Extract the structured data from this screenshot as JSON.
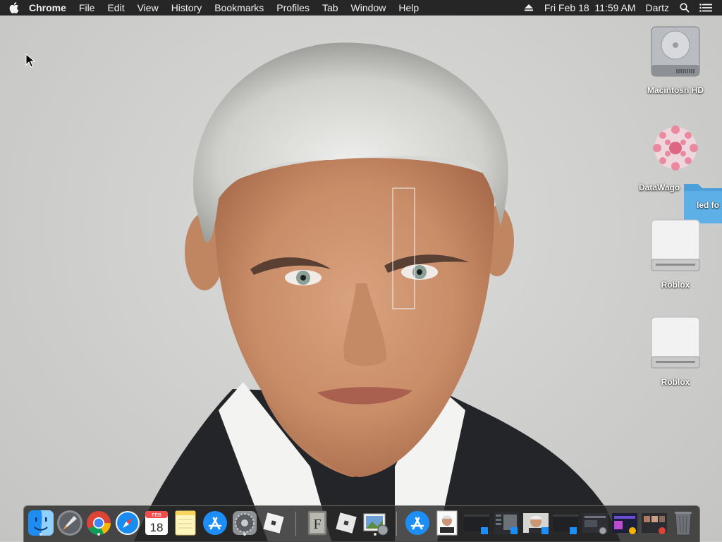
{
  "menubar": {
    "app_name": "Chrome",
    "menus": [
      "File",
      "Edit",
      "View",
      "History",
      "Bookmarks",
      "Profiles",
      "Tab",
      "Window",
      "Help"
    ],
    "datetime": "Fri Feb 18  11:59 AM",
    "user": "Dartz",
    "icons": [
      "apple-icon",
      "eject-icon",
      "spotlight-search-icon",
      "notification-center-icon"
    ]
  },
  "desktop": {
    "icons": [
      {
        "label": "Macintosh HD",
        "icon": "hard-drive-icon"
      },
      {
        "label": "DataWago",
        "icon": "datawago-icon"
      },
      {
        "label": "led fo",
        "icon": "folder-icon"
      },
      {
        "label": "Roblox",
        "icon": "disk-image-icon"
      },
      {
        "label": "Roblox",
        "icon": "disk-image-icon"
      }
    ]
  },
  "dock": {
    "calendar_month": "FEB",
    "calendar_day": "18",
    "textedit_letter": "F",
    "items": [
      "finder-icon",
      "launchpad-icon",
      "chrome-icon",
      "safari-icon",
      "calendar-icon",
      "notes-icon",
      "app-store-icon",
      "system-preferences-icon",
      "roblox-studio-icon",
      "font-book-icon",
      "roblox-icon",
      "preview-icon",
      "app-store-downloads-icon",
      "document-thumbnail",
      "window-thumbnails",
      "trash-icon"
    ],
    "running": [
      "finder-icon",
      "chrome-icon",
      "system-preferences-icon",
      "preview-icon"
    ]
  },
  "colors": {
    "menubar_bg": "#262626",
    "dock_bg": "#282828",
    "folder_blue": "#5db0e6"
  }
}
